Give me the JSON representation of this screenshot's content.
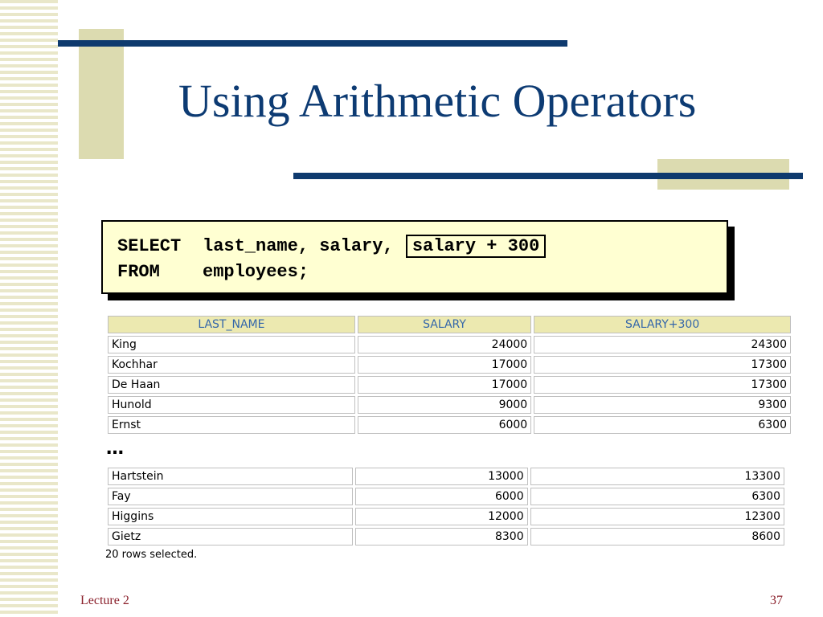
{
  "slide": {
    "title": "Using Arithmetic Operators",
    "footer_left": "Lecture 2",
    "page_number": "37",
    "accent_color": "#0e3a6e",
    "block_color": "#dcdbb0"
  },
  "sql": {
    "line1_keyword": "SELECT",
    "line1_rest": "last_name, salary,",
    "line1_highlight": "salary + 300",
    "line2_keyword": "FROM",
    "line2_rest": "employees;"
  },
  "result": {
    "headers": [
      "LAST_NAME",
      "SALARY",
      "SALARY+300"
    ],
    "rows_top": [
      [
        "King",
        "24000",
        "24300"
      ],
      [
        "Kochhar",
        "17000",
        "17300"
      ],
      [
        "De Haan",
        "17000",
        "17300"
      ],
      [
        "Hunold",
        "9000",
        "9300"
      ],
      [
        "Ernst",
        "6000",
        "6300"
      ]
    ],
    "ellipsis": "…",
    "rows_bottom": [
      [
        "Hartstein",
        "13000",
        "13300"
      ],
      [
        "Fay",
        "6000",
        "6300"
      ],
      [
        "Higgins",
        "12000",
        "12300"
      ],
      [
        "Gietz",
        "8300",
        "8600"
      ]
    ],
    "status": "20 rows selected."
  }
}
